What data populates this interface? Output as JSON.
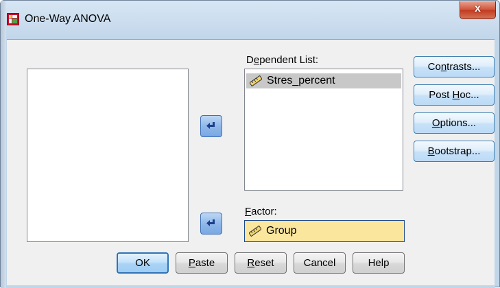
{
  "window": {
    "title": "One-Way ANOVA",
    "close_glyph": "x"
  },
  "dependent_list": {
    "label_pre": "D",
    "label_u": "e",
    "label_post": "pendent List:",
    "items": [
      {
        "label": "Stres_percent",
        "icon": "scale-ruler-icon",
        "selected": true
      }
    ]
  },
  "factor": {
    "label_u": "F",
    "label_post": "actor:",
    "value": "Group",
    "icon": "scale-ruler-icon",
    "highlight_color": "#fbe69e"
  },
  "side_buttons": [
    {
      "pre": "Co",
      "u": "n",
      "post": "trasts..."
    },
    {
      "pre": "Post ",
      "u": "H",
      "post": "oc..."
    },
    {
      "pre": "",
      "u": "O",
      "post": "ptions..."
    },
    {
      "pre": "",
      "u": "B",
      "post": "ootstrap..."
    }
  ],
  "bottom_buttons": [
    {
      "pre": "OK",
      "u": "",
      "post": ""
    },
    {
      "pre": "",
      "u": "P",
      "post": "aste"
    },
    {
      "pre": "",
      "u": "R",
      "post": "eset"
    },
    {
      "pre": "Cancel",
      "u": "",
      "post": ""
    },
    {
      "pre": "Help",
      "u": "",
      "post": ""
    }
  ],
  "colors": {
    "accent": "#2f73b4",
    "selection": "#c8c8c8",
    "close": "#c23a1f"
  }
}
